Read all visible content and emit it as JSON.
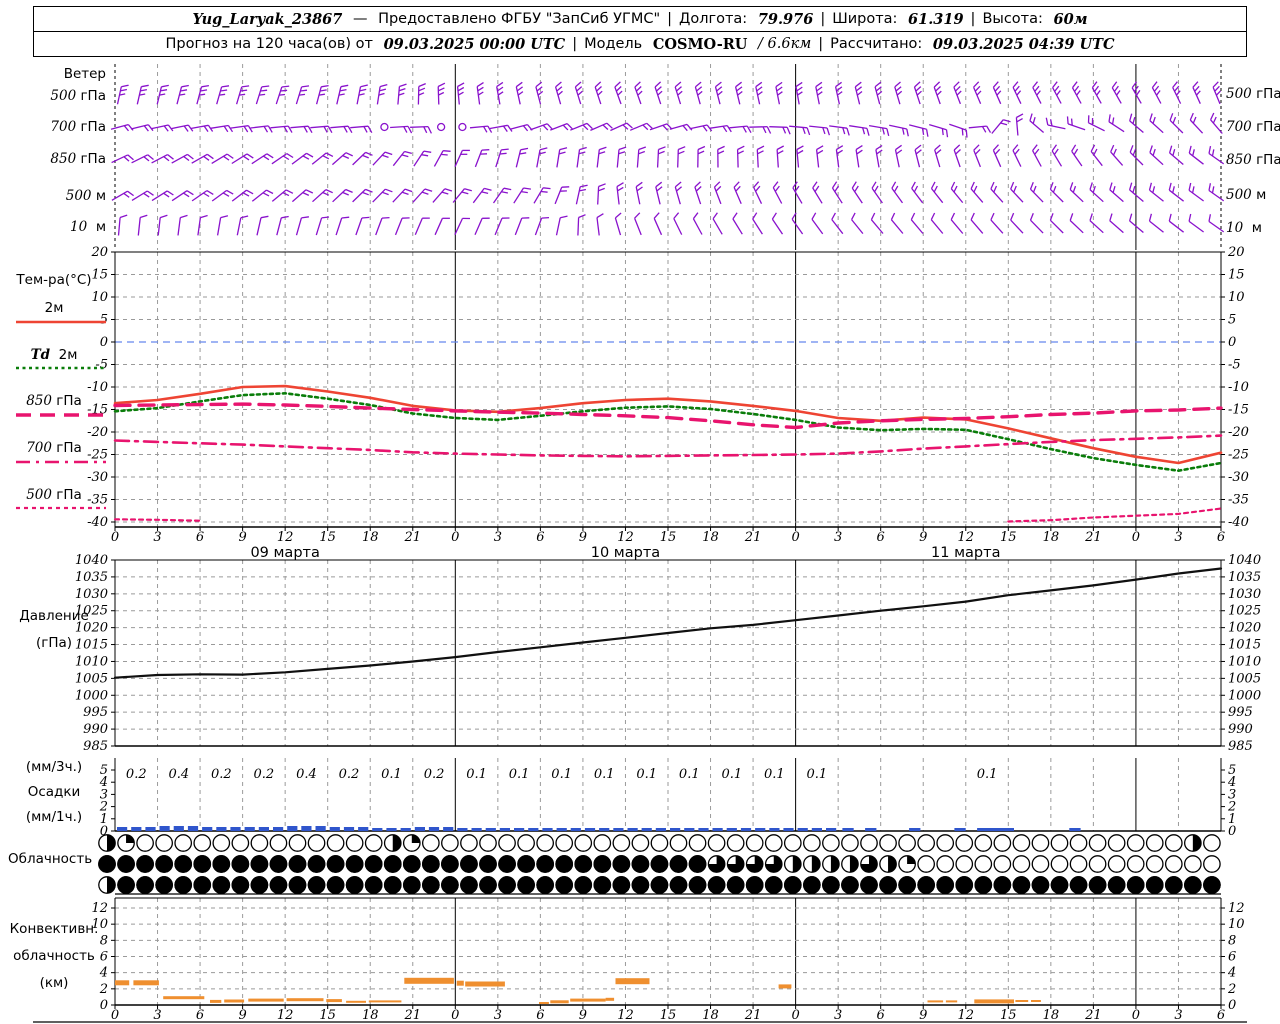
{
  "header": {
    "station": "Yug_Laryak_23867",
    "dash": "—",
    "provider": "Предоставлено ФГБУ \"ЗапСиб УГМС\"",
    "sep": "|",
    "lon_label": "Долгота:",
    "lon": "79.976",
    "lat_label": "Широта:",
    "lat": "61.319",
    "alt_label": "Высота:",
    "alt": "60м",
    "forecast_label": "Прогноз на 120 часа(ов) от",
    "forecast_time": "09.03.2025 00:00 UTC",
    "model_label": "Модель",
    "model": "COSMO-RU",
    "model_res": "/ 6.6км",
    "calc_label": "Рассчитано:",
    "calc_time": "09.03.2025 04:39 UTC"
  },
  "wind": {
    "title": "Ветер",
    "levels": [
      {
        "num": "500",
        "unit": "гПа"
      },
      {
        "num": "700",
        "unit": "гПа"
      },
      {
        "num": "850",
        "unit": "гПа"
      },
      {
        "num": "500",
        "unit": "м"
      },
      {
        "num": "10",
        "unit": "м"
      }
    ],
    "color": "#8912cc"
  },
  "temperature": {
    "title": "Тем-ра(°C)",
    "legend": [
      {
        "pre": "",
        "label": "2м"
      },
      {
        "pre": "Td",
        "label": "2м"
      },
      {
        "pre": "850",
        "label": "гПа"
      },
      {
        "pre": "700",
        "label": "гПа"
      },
      {
        "pre": "500",
        "label": "гПа"
      }
    ]
  },
  "pressure": {
    "label1": "Давление",
    "label2": "(гПа)"
  },
  "precip": {
    "label1": "(мм/3ч.)",
    "label2": "Осадки",
    "label3": "(мм/1ч.)"
  },
  "cloud": {
    "label": "Облачность"
  },
  "convective": {
    "label1": "Конвективн.",
    "label2": "облачность",
    "label3": "(км)"
  },
  "time_axis": {
    "total_hours": 78,
    "step": 3,
    "day_labels": [
      "09 марта",
      "10 марта",
      "11 марта"
    ],
    "day_starts": [
      24,
      48,
      72
    ],
    "day_label_hours": [
      12,
      36,
      60
    ]
  },
  "chart_data": [
    {
      "type": "wind-barbs",
      "panel": "wind",
      "color": "#8912cc",
      "sample_hours": [
        0,
        6,
        12,
        18,
        24,
        30,
        36,
        42,
        48,
        54,
        60,
        66,
        72,
        78
      ],
      "rows": [
        {
          "level": "500 гПа",
          "angles": [
            12,
            15,
            18,
            10,
            -5,
            -15,
            -20,
            -15,
            -10,
            -15,
            -22,
            -28,
            -30,
            -22
          ],
          "ticks": 3
        },
        {
          "level": "700 гПа",
          "angles": [
            75,
            80,
            85,
            85,
            90,
            70,
            65,
            80,
            95,
            100,
            110,
            -80,
            -50,
            -40
          ],
          "ticks": 2,
          "calm_hours": [
            19,
            23,
            24.5
          ]
        },
        {
          "level": "850 гПа",
          "angles": [
            65,
            60,
            55,
            45,
            25,
            10,
            5,
            0,
            -5,
            -10,
            -20,
            -30,
            -45,
            -55
          ],
          "ticks": 2
        },
        {
          "level": "500 м",
          "angles": [
            60,
            55,
            50,
            45,
            40,
            30,
            -10,
            -20,
            -30,
            -35,
            -40,
            -45,
            -50,
            -55
          ],
          "ticks": 2
        },
        {
          "level": "10 м",
          "angles": [
            5,
            8,
            15,
            20,
            25,
            20,
            -20,
            -30,
            -35,
            -40,
            -40,
            -45,
            -50,
            -55
          ],
          "ticks": 1
        }
      ]
    },
    {
      "type": "line",
      "panel": "temperature",
      "title": "Тем-ра(°C)",
      "ylim": [
        -40,
        20
      ],
      "yticks": [
        20,
        15,
        10,
        5,
        0,
        -5,
        -10,
        -15,
        -20,
        -25,
        -30,
        -35,
        -40
      ],
      "x_step_hours": 3,
      "zero_line_color": "#6688ee",
      "series": [
        {
          "name": "2м",
          "color": "#ee4433",
          "dash": "solid",
          "width": 2.6,
          "values": [
            -13.6,
            -12.9,
            -11.5,
            -10.0,
            -9.8,
            -11.0,
            -12.4,
            -14.2,
            -15.2,
            -15.5,
            -14.7,
            -13.6,
            -12.9,
            -12.6,
            -13.2,
            -14.2,
            -15.3,
            -16.9,
            -17.5,
            -16.8,
            -17.2,
            -19.2,
            -21.4,
            -23.6,
            -25.5,
            -26.9,
            -24.6
          ]
        },
        {
          "name": "Td 2м",
          "color": "#0a7d0a",
          "dash": "dotted",
          "width": 2.6,
          "values": [
            -15.4,
            -14.7,
            -13.2,
            -11.8,
            -11.4,
            -12.6,
            -14.0,
            -15.9,
            -16.9,
            -17.3,
            -16.4,
            -15.4,
            -14.6,
            -14.3,
            -14.9,
            -16.0,
            -17.3,
            -19.0,
            -19.6,
            -19.3,
            -19.5,
            -21.6,
            -23.8,
            -25.8,
            -27.3,
            -28.6,
            -26.9
          ]
        },
        {
          "name": "850 гПа",
          "color": "#e8146e",
          "dash": "longdash",
          "width": 3.4,
          "values": [
            -14.1,
            -14.0,
            -13.9,
            -13.8,
            -14.0,
            -14.3,
            -14.7,
            -15.0,
            -15.3,
            -15.6,
            -15.8,
            -16.1,
            -16.4,
            -16.8,
            -17.5,
            -18.4,
            -19.0,
            -18.0,
            -17.5,
            -17.2,
            -17.0,
            -16.6,
            -16.1,
            -15.8,
            -15.3,
            -15.1,
            -14.7
          ]
        },
        {
          "name": "700 гПа",
          "color": "#e8146e",
          "dash": "dashdot",
          "width": 2.6,
          "values": [
            -21.9,
            -22.2,
            -22.5,
            -22.8,
            -23.2,
            -23.6,
            -24.0,
            -24.5,
            -24.8,
            -25.0,
            -25.2,
            -25.3,
            -25.4,
            -25.3,
            -25.2,
            -25.1,
            -25.0,
            -24.8,
            -24.3,
            -23.7,
            -23.2,
            -22.7,
            -22.2,
            -21.8,
            -21.5,
            -21.2,
            -20.8
          ]
        },
        {
          "name": "500 гПа",
          "color": "#e8146e",
          "dash": "shortdash",
          "width": 2.2,
          "values": [
            -39.4,
            -39.5,
            -39.7,
            null,
            null,
            null,
            null,
            null,
            null,
            null,
            null,
            null,
            null,
            null,
            null,
            null,
            null,
            null,
            null,
            null,
            null,
            -39.9,
            -39.6,
            -39.0,
            -38.6,
            -38.2,
            -37.0
          ]
        }
      ]
    },
    {
      "type": "line",
      "panel": "pressure",
      "title": "Давление (гПа)",
      "ylim": [
        985,
        1040
      ],
      "yticks": [
        1040,
        1035,
        1030,
        1025,
        1020,
        1015,
        1010,
        1005,
        1000,
        995,
        990,
        985
      ],
      "x_step_hours": 3,
      "series": [
        {
          "name": "Давление",
          "color": "#101010",
          "dash": "solid",
          "width": 2.2,
          "values": [
            1005.2,
            1006.0,
            1006.2,
            1006.1,
            1006.8,
            1007.8,
            1008.8,
            1010.0,
            1011.3,
            1012.8,
            1014.2,
            1015.6,
            1017.0,
            1018.4,
            1019.8,
            1020.8,
            1022.2,
            1023.6,
            1025.0,
            1026.3,
            1027.7,
            1029.6,
            1031.0,
            1032.5,
            1034.2,
            1036.0,
            1037.5
          ]
        }
      ]
    },
    {
      "type": "bar",
      "panel": "precip",
      "title": "Осадки",
      "unit_3h": "мм/3ч.",
      "unit_1h": "мм/1ч.",
      "yticks": [
        5,
        4,
        3,
        2,
        1,
        0
      ],
      "bar_color": "#2f55cc",
      "values_3h": [
        0.2,
        0.4,
        0.2,
        0.2,
        0.4,
        0.2,
        0.1,
        0.2,
        0.1,
        0.1,
        0.1,
        0.1,
        0.1,
        0.1,
        0.1,
        0.1,
        0.1,
        null,
        null,
        null,
        0.1,
        null,
        null,
        null,
        null,
        null
      ],
      "extra_bar_hours": [
        [
          51.3,
          52.1
        ],
        [
          52.9,
          53.7
        ],
        [
          56.0,
          56.8
        ],
        [
          59.2,
          60.0
        ],
        [
          60.8,
          63.4
        ],
        [
          67.3,
          68.1
        ]
      ]
    },
    {
      "type": "cloud-cover-rows",
      "panel": "cloud",
      "rows": [
        {
          "fractions": [
            0.5,
            0.25,
            0,
            0,
            0,
            0,
            0,
            0,
            0,
            0,
            0,
            0,
            0,
            0,
            0,
            0.5,
            0.25,
            0,
            0,
            0,
            0,
            0,
            0,
            0,
            0,
            0,
            0,
            0,
            0,
            0,
            0,
            0,
            0,
            0,
            0,
            0,
            0,
            0,
            0,
            0,
            0,
            0,
            0,
            0,
            0,
            0,
            0,
            0,
            0,
            0,
            0,
            0,
            0,
            0,
            0,
            0,
            0,
            0.5,
            0
          ]
        },
        {
          "fractions": [
            1,
            1,
            1,
            1,
            1,
            1,
            1,
            1,
            1,
            1,
            1,
            1,
            1,
            1,
            1,
            1,
            1,
            1,
            1,
            1,
            1,
            1,
            1,
            1,
            1,
            1,
            1,
            1,
            1,
            1,
            1,
            1,
            0.75,
            0.75,
            0.75,
            0.75,
            0.5,
            0.5,
            0.5,
            0.5,
            0.75,
            0.5,
            0.25,
            0,
            0,
            0,
            0,
            0,
            0,
            0,
            0,
            0,
            0,
            0,
            0,
            0,
            0,
            0,
            0
          ]
        },
        {
          "fractions": [
            0.5,
            1,
            1,
            1,
            1,
            1,
            1,
            1,
            1,
            1,
            1,
            1,
            1,
            1,
            1,
            1,
            1,
            1,
            1,
            1,
            1,
            1,
            1,
            1,
            1,
            1,
            1,
            1,
            1,
            1,
            1,
            1,
            1,
            1,
            1,
            1,
            1,
            1,
            1,
            1,
            1,
            1,
            1,
            1,
            1,
            1,
            1,
            1,
            1,
            1,
            1,
            1,
            1,
            1,
            1,
            1,
            1,
            1,
            1
          ]
        }
      ]
    },
    {
      "type": "range-bars",
      "panel": "convective",
      "title": "Конвективная облачность (км)",
      "yticks": [
        12,
        10,
        8,
        6,
        4,
        2,
        0
      ],
      "color": "#ef8f2f",
      "bars": [
        [
          0,
          1,
          2.75,
          5
        ],
        [
          1.3,
          3.1,
          2.75,
          5
        ],
        [
          3.4,
          6.3,
          0.9,
          3
        ],
        [
          6.7,
          7.5,
          0.45,
          3
        ],
        [
          7.7,
          9.1,
          0.5,
          3
        ],
        [
          9.4,
          11.9,
          0.6,
          3
        ],
        [
          12.1,
          14.7,
          0.65,
          3
        ],
        [
          14.9,
          16,
          0.55,
          3
        ],
        [
          16.3,
          17.7,
          0.4,
          2
        ],
        [
          17.9,
          20.2,
          0.45,
          2
        ],
        [
          20.4,
          23.9,
          3.0,
          6
        ],
        [
          24.1,
          24.6,
          2.7,
          5
        ],
        [
          24.7,
          27.5,
          2.6,
          5
        ],
        [
          29.9,
          30.6,
          0.25,
          2
        ],
        [
          30.7,
          32,
          0.4,
          3
        ],
        [
          32.1,
          34.6,
          0.6,
          3
        ],
        [
          34.6,
          35.2,
          0.7,
          3
        ],
        [
          35.3,
          37.7,
          2.95,
          6
        ],
        [
          46.8,
          47.7,
          2.3,
          4
        ],
        [
          57.3,
          58.4,
          0.45,
          2
        ],
        [
          58.6,
          59.4,
          0.45,
          2
        ],
        [
          60.6,
          63.4,
          0.45,
          4
        ],
        [
          63.5,
          64.4,
          0.5,
          2
        ],
        [
          64.6,
          65.3,
          0.5,
          2
        ]
      ]
    }
  ]
}
